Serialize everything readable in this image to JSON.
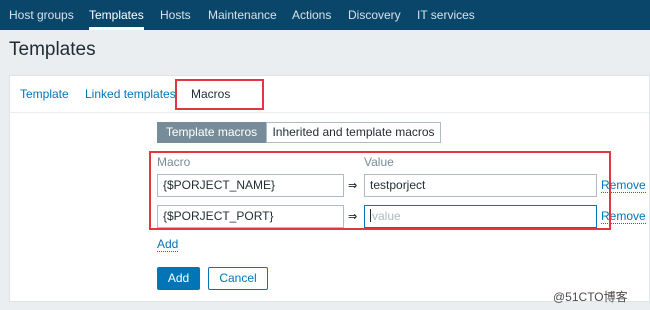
{
  "topnav": {
    "items": [
      {
        "label": "Host groups",
        "active": false
      },
      {
        "label": "Templates",
        "active": true
      },
      {
        "label": "Hosts",
        "active": false
      },
      {
        "label": "Maintenance",
        "active": false
      },
      {
        "label": "Actions",
        "active": false
      },
      {
        "label": "Discovery",
        "active": false
      },
      {
        "label": "IT services",
        "active": false
      }
    ]
  },
  "page": {
    "title": "Templates"
  },
  "tabs": [
    {
      "label": "Template",
      "active": false
    },
    {
      "label": "Linked templates",
      "active": false
    },
    {
      "label": "Macros",
      "active": true
    }
  ],
  "macro_scope": {
    "options": [
      "Template macros",
      "Inherited and template macros"
    ],
    "selected": "Template macros"
  },
  "macros": {
    "header_macro": "Macro",
    "header_value": "Value",
    "arrow": "⇒",
    "rows": [
      {
        "macro": "{$PORJECT_NAME}",
        "value": "testporject",
        "value_placeholder": "",
        "remove_label": "Remove"
      },
      {
        "macro": "{$PORJECT_PORT}",
        "value": "",
        "value_placeholder": "value",
        "remove_label": "Remove"
      }
    ],
    "add_link": "Add"
  },
  "form_actions": {
    "add_label": "Add",
    "cancel_label": "Cancel"
  },
  "watermark": "@51CTO博客",
  "colors": {
    "nav_bg": "#0a466a",
    "link": "#0275b8",
    "highlight": "#e0383e",
    "seg_active": "#768d99"
  }
}
